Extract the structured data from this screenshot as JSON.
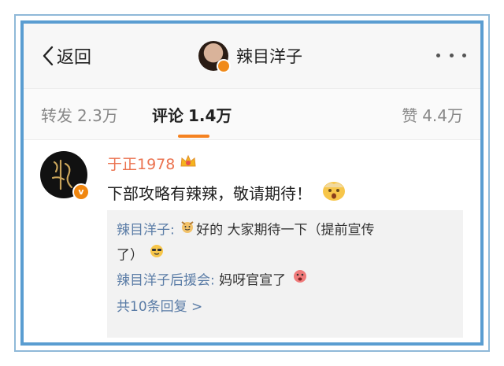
{
  "nav": {
    "back_label": "返回",
    "title": "辣目洋子"
  },
  "tabs": {
    "repost": {
      "label": "转发",
      "count": "2.3万"
    },
    "comment": {
      "label": "评论",
      "count": "1.4万"
    },
    "like": {
      "label": "赞",
      "count": "4.4万"
    }
  },
  "comment": {
    "username": "于正1978",
    "avatar_text": "v",
    "text": "下部攻略有辣辣，敬请期待！",
    "replies": [
      {
        "user": "辣目洋子:",
        "text_a": "好的 大家期待一下（提前宣传了）",
        "text_a1": "好的 大家期待一下（提前宣传",
        "text_a2": "了）"
      },
      {
        "user": "辣目洋子后援会:",
        "text": " 妈呀官宣了"
      }
    ],
    "more_replies": "共10条回复 >"
  },
  "colors": {
    "accent": "#f58220",
    "link": "#5a7ca6",
    "username": "#eb7350",
    "frame": "#5a9dd1"
  }
}
